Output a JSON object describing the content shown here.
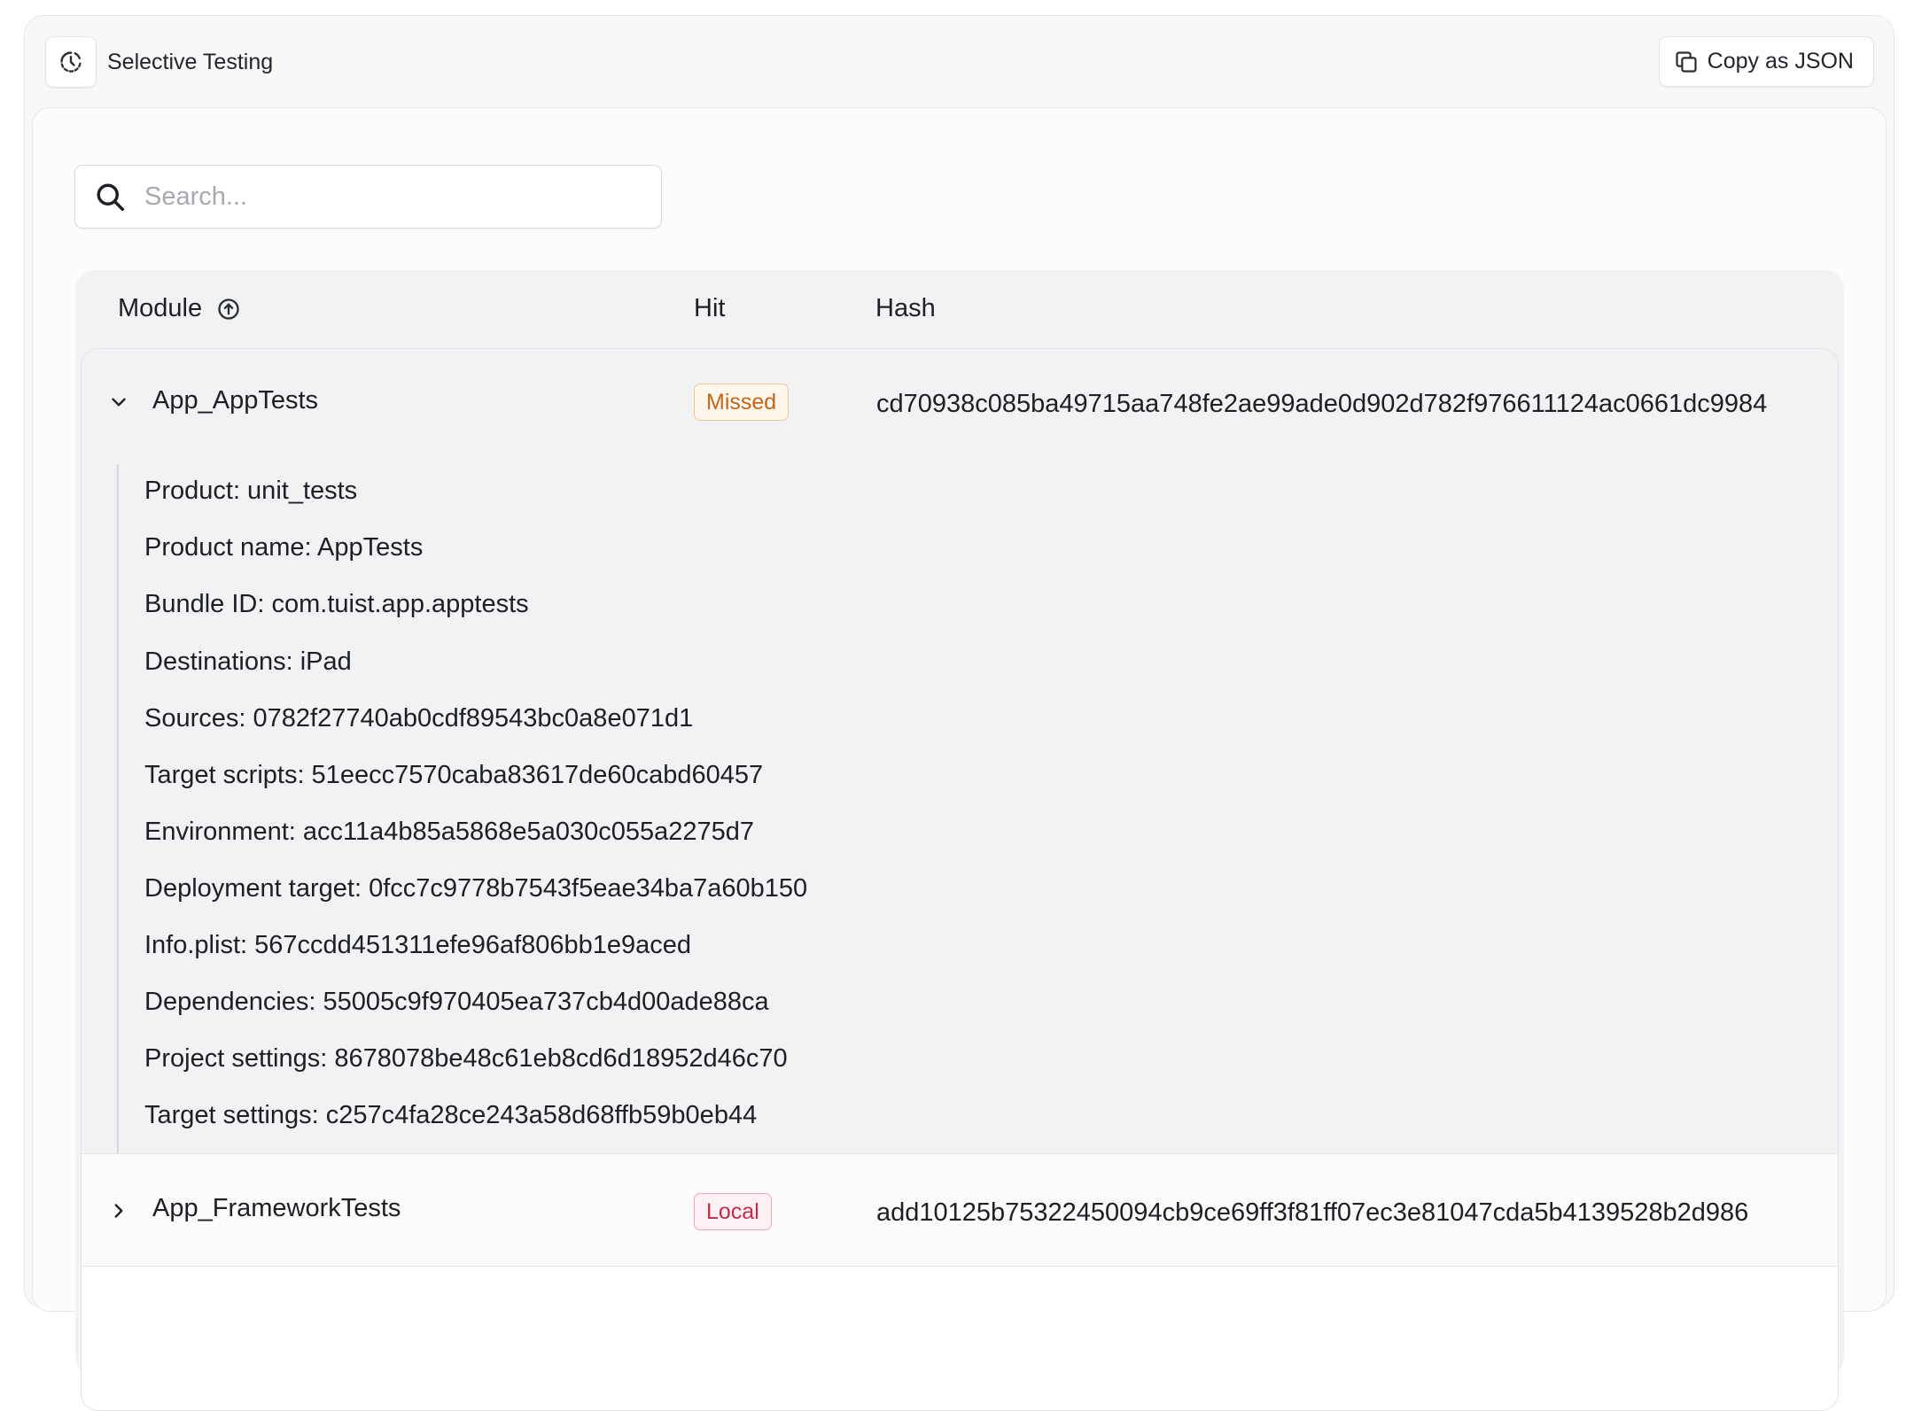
{
  "header": {
    "title": "Selective Testing",
    "icon": "history-clock-icon",
    "copy_button_label": "Copy as JSON",
    "copy_icon": "copy-icon"
  },
  "search": {
    "placeholder": "Search...",
    "value": ""
  },
  "table": {
    "columns": {
      "module": "Module",
      "hit": "Hit",
      "hash": "Hash"
    },
    "sort": {
      "column": "Module",
      "direction": "ascending",
      "icon": "sort-arrow-up-icon"
    },
    "rows": [
      {
        "module": "App_AppTests",
        "hit": "Missed",
        "hash": "cd70938c085ba49715aa748fe2ae99ade0d902d782f976611124ac0661dc9984",
        "expanded": true,
        "details": [
          "Product: unit_tests",
          "Product name: AppTests",
          "Bundle ID: com.tuist.app.apptests",
          "Destinations: iPad",
          "Sources: 0782f27740ab0cdf89543bc0a8e071d1",
          "Target scripts: 51eecc7570caba83617de60cabd60457",
          "Environment: acc11a4b85a5868e5a030c055a2275d7",
          "Deployment target: 0fcc7c9778b7543f5eae34ba7a60b150",
          "Info.plist: 567ccdd451311efe96af806bb1e9aced",
          "Dependencies: 55005c9f970405ea737cb4d00ade88ca",
          "Project settings: 8678078be48c61eb8cd6d18952d46c70",
          "Target settings: c257c4fa28ce243a58d68ffb59b0eb44"
        ]
      },
      {
        "module": "App_FrameworkTests",
        "hit": "Local",
        "hash": "add10125b75322450094cb9ce69ff3f81ff07ec3e81047cda5b4139528b2d986",
        "expanded": false
      }
    ]
  },
  "colors": {
    "missed_badge": "#c4651a",
    "local_badge": "#c22b4e",
    "expanded_row_bg": "#f1f2f4"
  }
}
